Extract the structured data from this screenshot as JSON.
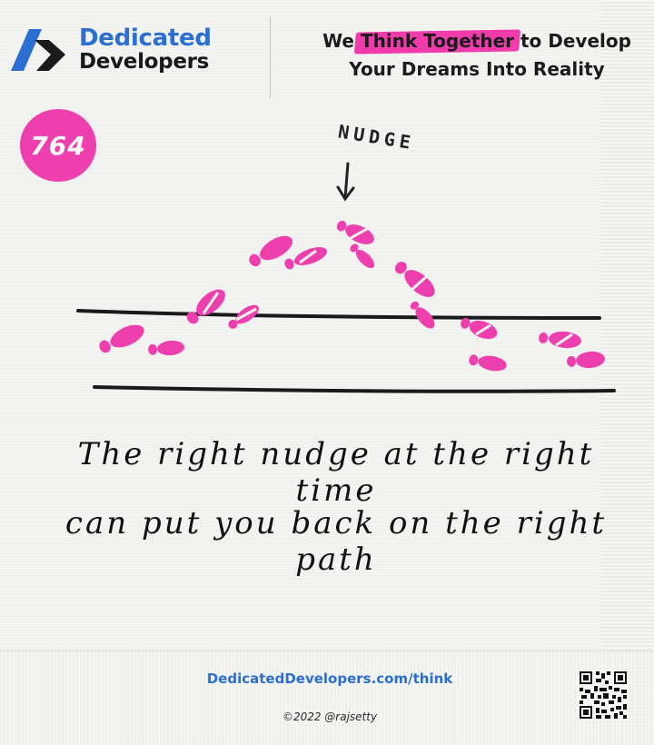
{
  "brand": {
    "name_line1": "Dedicated",
    "name_line2": "Developers",
    "primary_color": "#2a6fd1",
    "dark_color": "#1a1a1a"
  },
  "tagline": {
    "pre": "We ",
    "highlight": "Think Together",
    "post": " to Develop",
    "line2": "Your Dreams Into Reality",
    "highlight_color": "#f03cab"
  },
  "badge": {
    "number": "764",
    "color": "#ee3fae"
  },
  "illustration": {
    "label": "NUDGE",
    "footprint_color": "#ee3fae"
  },
  "caption": {
    "line1": "The right nudge at the right time",
    "line2": "can put you back on the right path"
  },
  "footer": {
    "link": "DedicatedDevelopers.com/think",
    "copyright": "©2022 @rajsetty",
    "qr_icon": "qr-code-icon"
  }
}
